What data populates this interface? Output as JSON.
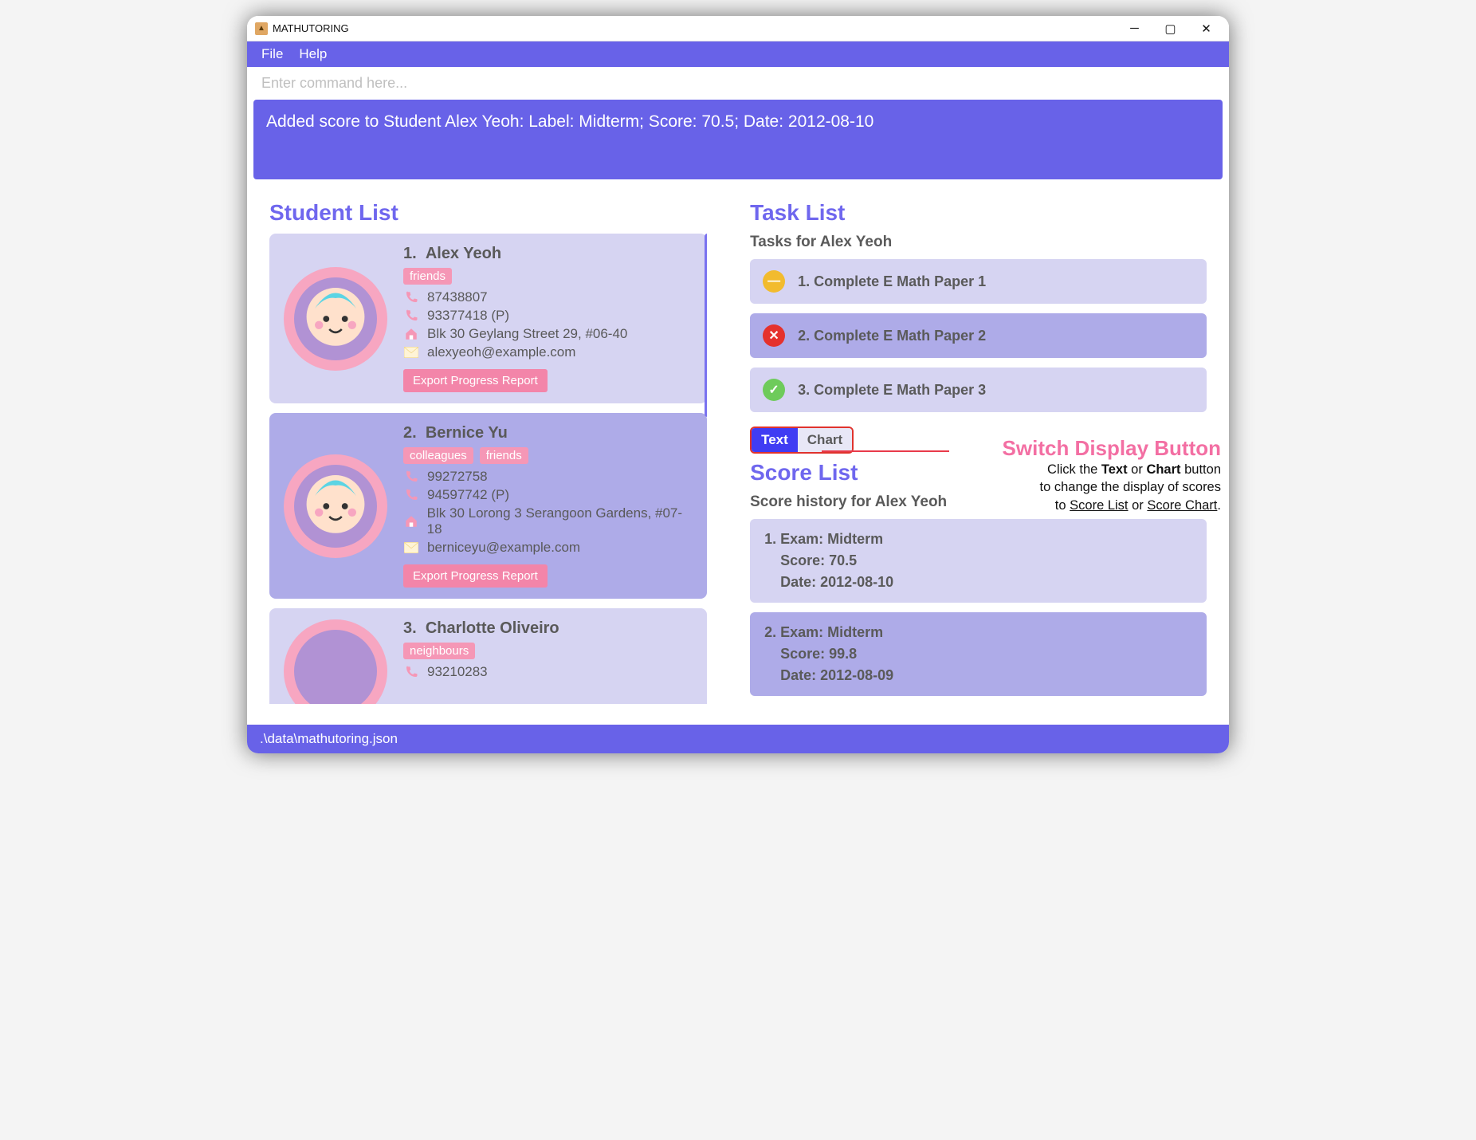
{
  "window": {
    "title": "MATHUTORING"
  },
  "menubar": {
    "file": "File",
    "help": "Help"
  },
  "command": {
    "placeholder": "Enter command here..."
  },
  "message": "Added score to Student Alex Yeoh: Label: Midterm; Score: 70.5; Date: 2012-08-10",
  "student_list": {
    "heading": "Student List",
    "export_label": "Export Progress Report",
    "students": [
      {
        "index": "1.",
        "name": "Alex Yeoh",
        "tags": [
          "friends"
        ],
        "phone": "87438807",
        "parent_phone": "93377418 (P)",
        "address": "Blk 30 Geylang Street 29, #06-40",
        "email": "alexyeoh@example.com"
      },
      {
        "index": "2.",
        "name": "Bernice Yu",
        "tags": [
          "colleagues",
          "friends"
        ],
        "phone": "99272758",
        "parent_phone": "94597742 (P)",
        "address": "Blk 30 Lorong 3 Serangoon Gardens, #07-18",
        "email": "berniceyu@example.com"
      },
      {
        "index": "3.",
        "name": "Charlotte Oliveiro",
        "tags": [
          "neighbours"
        ],
        "phone": "93210283",
        "parent_phone": "",
        "address": "",
        "email": ""
      }
    ]
  },
  "task_list": {
    "heading": "Task List",
    "subhead": "Tasks for Alex Yeoh",
    "tasks": [
      {
        "index": "1.",
        "title": "Complete E Math Paper 1",
        "status": "late"
      },
      {
        "index": "2.",
        "title": "Complete E Math Paper 2",
        "status": "inprogress"
      },
      {
        "index": "3.",
        "title": "Complete E Math Paper 3",
        "status": "done"
      }
    ]
  },
  "score_toggle": {
    "text": "Text",
    "chart": "Chart",
    "active": "Text"
  },
  "score_list": {
    "heading": "Score List",
    "subhead": "Score history for Alex Yeoh",
    "scores": [
      {
        "index": "1.",
        "exam": "Midterm",
        "score": "70.5",
        "date": "2012-08-10"
      },
      {
        "index": "2.",
        "exam": "Midterm",
        "score": "99.8",
        "date": "2012-08-09"
      }
    ]
  },
  "statusbar": ".\\data\\mathutoring.json",
  "annotation": {
    "title": "Switch Display Button",
    "line1_a": "Click the ",
    "line1_b": "Text",
    "line1_c": " or ",
    "line1_d": "Chart",
    "line1_e": " button",
    "line2": "to change the display of scores",
    "line3_a": "to ",
    "line3_b": "Score List",
    "line3_c": " or ",
    "line3_d": "Score Chart",
    "line3_e": "."
  },
  "labels": {
    "exam_prefix": "Exam: ",
    "score_prefix": "Score: ",
    "date_prefix": "Date: "
  }
}
